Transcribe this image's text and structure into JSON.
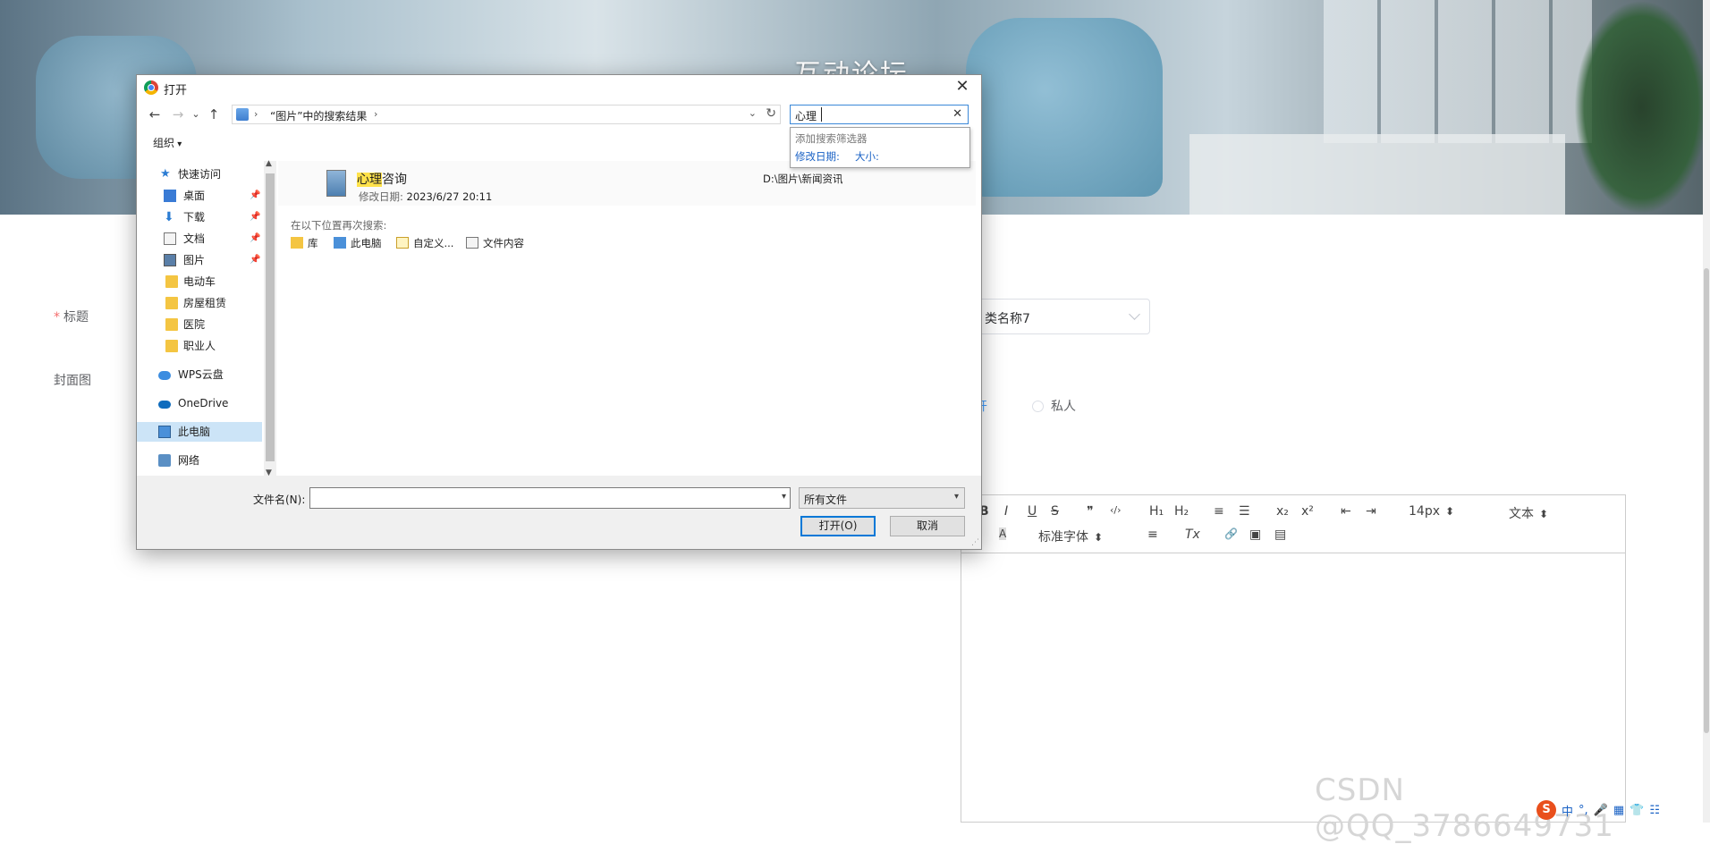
{
  "page": {
    "hero_title": "互动论坛",
    "labels": {
      "title": "标题",
      "cover": "封面图"
    },
    "category_value": "类名称7",
    "visibility_options": [
      "公开",
      "私人"
    ],
    "editor_toolbar": {
      "row1": [
        "B",
        "I",
        "U",
        "S",
        "❞",
        "‹/›",
        "H₁",
        "H₂",
        "≡",
        "☰",
        "x₂",
        "x²",
        "⇤",
        "⇥",
        "14px",
        "文本"
      ],
      "row2": [
        "A",
        "A",
        "标准字体",
        "≡",
        "Tx",
        "🔗",
        "▣",
        "▤"
      ]
    },
    "watermark": "CSDN @QQ_3786649731",
    "tray_items": [
      "S",
      "中",
      "°,",
      "🎤",
      "▦",
      "👕",
      "☷"
    ]
  },
  "dialog": {
    "title": "打开",
    "close_label": "✕",
    "nav": {
      "back": "←",
      "forward": "→",
      "recent": "⌄",
      "up": "↑"
    },
    "address": {
      "crumb": "“图片”中的搜索结果",
      "sep": "›"
    },
    "search": {
      "query": "心理",
      "clear": "✕"
    },
    "suggest": {
      "header": "添加搜索筛选器",
      "filters": [
        "修改日期:",
        "大小:"
      ]
    },
    "organize_label": "组织",
    "sidebar": [
      {
        "label": "快速访问",
        "icon": "star-icon"
      },
      {
        "label": "桌面",
        "icon": "desktop-icon",
        "pinned": true
      },
      {
        "label": "下载",
        "icon": "download-icon",
        "pinned": true
      },
      {
        "label": "文档",
        "icon": "document-icon",
        "pinned": true
      },
      {
        "label": "图片",
        "icon": "pictures-icon",
        "pinned": true
      },
      {
        "label": "电动车",
        "icon": "folder-icon"
      },
      {
        "label": "房屋租赁",
        "icon": "folder-icon"
      },
      {
        "label": "医院",
        "icon": "folder-icon"
      },
      {
        "label": "职业人",
        "icon": "folder-icon"
      },
      {
        "label": "WPS云盘",
        "icon": "cloud-icon"
      },
      {
        "label": "OneDrive",
        "icon": "onedrive-icon"
      },
      {
        "label": "此电脑",
        "icon": "computer-icon",
        "selected": true
      },
      {
        "label": "网络",
        "icon": "network-icon"
      }
    ],
    "result": {
      "name_highlight": "心理",
      "name_rest": "咨询",
      "modified_label": "修改日期:",
      "modified_value": "2023/6/27 20:11",
      "path": "D:\\图片\\新闻资讯"
    },
    "search_again": {
      "label": "在以下位置再次搜索:",
      "links": [
        "库",
        "此电脑",
        "自定义...",
        "文件内容"
      ]
    },
    "filename_label": "文件名(N):",
    "filename_value": "",
    "filetype_value": "所有文件",
    "open_button": "打开(O)",
    "cancel_button": "取消"
  }
}
